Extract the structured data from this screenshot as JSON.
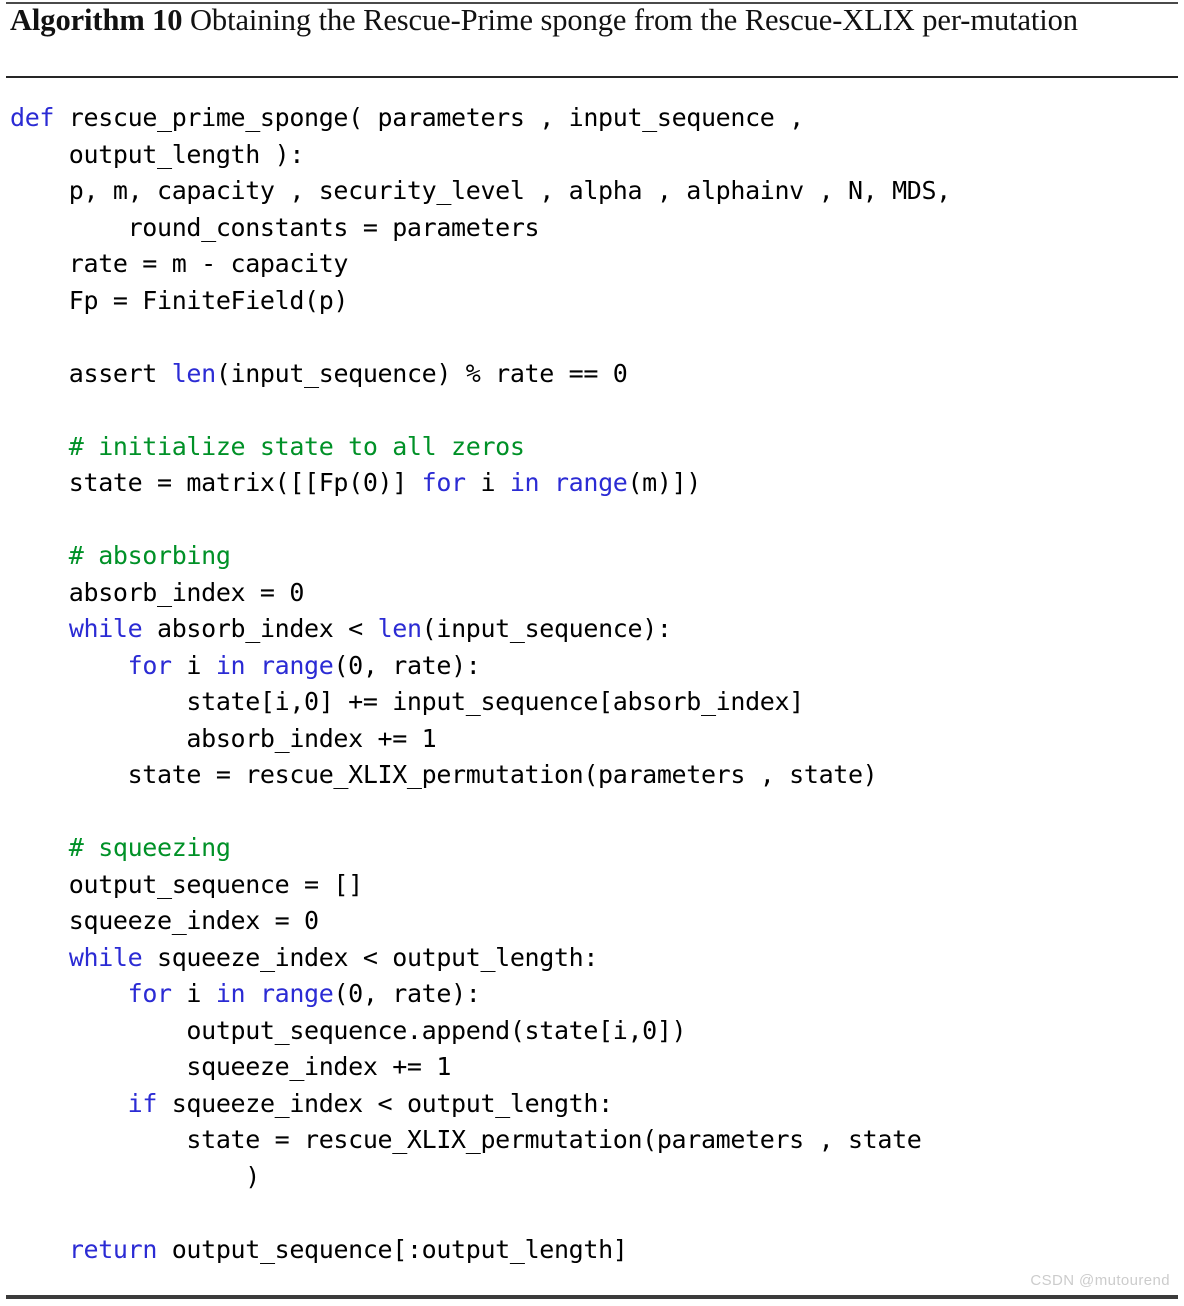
{
  "document": {
    "kind": "algorithm-float",
    "caption": {
      "label": "Algorithm 10",
      "title": "Obtaining the Rescue-Prime sponge from the Rescue-XLIX per-",
      "title_line2": "mutation",
      "full_title": "Algorithm 10 Obtaining the Rescue-Prime sponge from the Rescue-XLIX permutation"
    },
    "watermark": "CSDN @mutourend",
    "colors": {
      "keyword": "#2b2bd4",
      "comment": "#009127",
      "text": "#000000",
      "rule": "#3b3b3b",
      "watermark": "#cccccc",
      "background": "#ffffff"
    }
  },
  "code": {
    "language": "python",
    "lines": [
      [
        {
          "t": "def",
          "c": "kw"
        },
        {
          "t": " rescue_prime_sponge( parameters , input_sequence ,",
          "c": "plain"
        }
      ],
      [
        {
          "t": "    output_length ):",
          "c": "plain"
        }
      ],
      [
        {
          "t": "    p, m, capacity , security_level , alpha , alphainv , N, MDS,",
          "c": "plain"
        }
      ],
      [
        {
          "t": "        round_constants = parameters",
          "c": "plain"
        }
      ],
      [
        {
          "t": "    rate = m - capacity",
          "c": "plain"
        }
      ],
      [
        {
          "t": "    Fp = FiniteField(p)",
          "c": "plain"
        }
      ],
      [],
      [
        {
          "t": "    assert ",
          "c": "plain"
        },
        {
          "t": "len",
          "c": "kw"
        },
        {
          "t": "(input_sequence) % rate == 0",
          "c": "plain"
        }
      ],
      [],
      [
        {
          "t": "    # initialize state to all zeros",
          "c": "cmt"
        }
      ],
      [
        {
          "t": "    state = matrix([[Fp(0)] ",
          "c": "plain"
        },
        {
          "t": "for",
          "c": "kw"
        },
        {
          "t": " i ",
          "c": "plain"
        },
        {
          "t": "in",
          "c": "kw"
        },
        {
          "t": " ",
          "c": "plain"
        },
        {
          "t": "range",
          "c": "kw"
        },
        {
          "t": "(m)])",
          "c": "plain"
        }
      ],
      [],
      [
        {
          "t": "    # absorbing",
          "c": "cmt"
        }
      ],
      [
        {
          "t": "    absorb_index = 0",
          "c": "plain"
        }
      ],
      [
        {
          "t": "    ",
          "c": "plain"
        },
        {
          "t": "while",
          "c": "kw"
        },
        {
          "t": " absorb_index < ",
          "c": "plain"
        },
        {
          "t": "len",
          "c": "kw"
        },
        {
          "t": "(input_sequence):",
          "c": "plain"
        }
      ],
      [
        {
          "t": "        ",
          "c": "plain"
        },
        {
          "t": "for",
          "c": "kw"
        },
        {
          "t": " i ",
          "c": "plain"
        },
        {
          "t": "in",
          "c": "kw"
        },
        {
          "t": " ",
          "c": "plain"
        },
        {
          "t": "range",
          "c": "kw"
        },
        {
          "t": "(0, rate):",
          "c": "plain"
        }
      ],
      [
        {
          "t": "            state[i,0] += input_sequence[absorb_index]",
          "c": "plain"
        }
      ],
      [
        {
          "t": "            absorb_index += 1",
          "c": "plain"
        }
      ],
      [
        {
          "t": "        state = rescue_XLIX_permutation(parameters , state)",
          "c": "plain"
        }
      ],
      [],
      [
        {
          "t": "    # squeezing",
          "c": "cmt"
        }
      ],
      [
        {
          "t": "    output_sequence = []",
          "c": "plain"
        }
      ],
      [
        {
          "t": "    squeeze_index = 0",
          "c": "plain"
        }
      ],
      [
        {
          "t": "    ",
          "c": "plain"
        },
        {
          "t": "while",
          "c": "kw"
        },
        {
          "t": " squeeze_index < output_length:",
          "c": "plain"
        }
      ],
      [
        {
          "t": "        ",
          "c": "plain"
        },
        {
          "t": "for",
          "c": "kw"
        },
        {
          "t": " i ",
          "c": "plain"
        },
        {
          "t": "in",
          "c": "kw"
        },
        {
          "t": " ",
          "c": "plain"
        },
        {
          "t": "range",
          "c": "kw"
        },
        {
          "t": "(0, rate):",
          "c": "plain"
        }
      ],
      [
        {
          "t": "            output_sequence.append(state[i,0])",
          "c": "plain"
        }
      ],
      [
        {
          "t": "            squeeze_index += 1",
          "c": "plain"
        }
      ],
      [
        {
          "t": "        ",
          "c": "plain"
        },
        {
          "t": "if",
          "c": "kw"
        },
        {
          "t": " squeeze_index < output_length:",
          "c": "plain"
        }
      ],
      [
        {
          "t": "            state = rescue_XLIX_permutation(parameters , state",
          "c": "plain"
        }
      ],
      [
        {
          "t": "                )",
          "c": "plain"
        }
      ],
      [],
      [
        {
          "t": "    ",
          "c": "plain"
        },
        {
          "t": "return",
          "c": "kw"
        },
        {
          "t": " output_sequence[:output_length]",
          "c": "plain"
        }
      ]
    ]
  }
}
